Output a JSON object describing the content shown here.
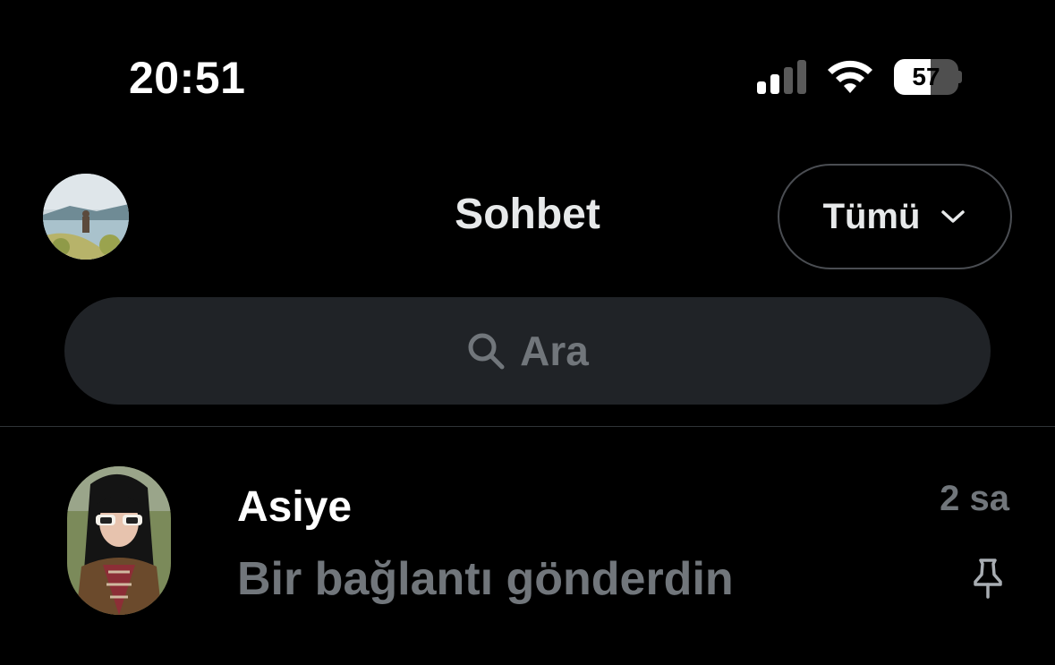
{
  "status_bar": {
    "time": "20:51",
    "battery_level": "57",
    "battery_fraction": 0.57,
    "signal_bars_active": 2,
    "signal_bars_total": 4,
    "icons": [
      "cellular-signal-icon",
      "wifi-icon",
      "battery-icon"
    ]
  },
  "header": {
    "title": "Sohbet",
    "filter_label": "Tümü",
    "filter_icon": "chevron-down-icon",
    "avatar_icon": "profile-avatar"
  },
  "search": {
    "placeholder": "Ara",
    "icon": "search-icon"
  },
  "conversations": [
    {
      "name": "Asiye",
      "time": "2 sa",
      "preview": "Bir bağlantı gönderdin",
      "pinned": true,
      "pin_icon": "pin-icon"
    }
  ],
  "colors": {
    "background": "#000000",
    "primary_text": "#e7e9ea",
    "secondary_text": "#71767b",
    "search_bg": "#202327",
    "border": "#4a4d52"
  }
}
